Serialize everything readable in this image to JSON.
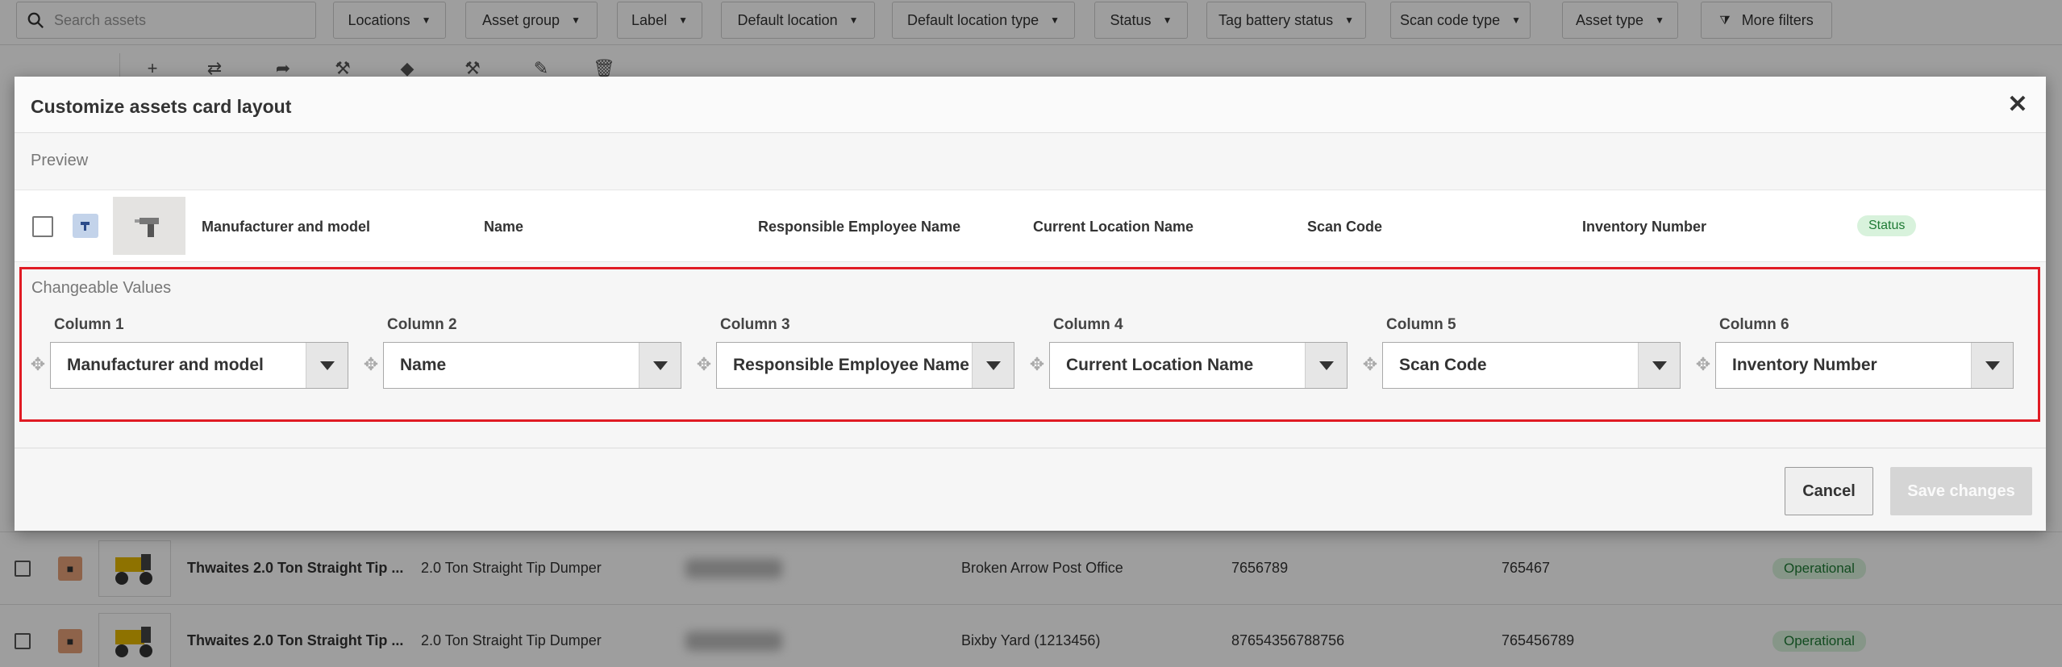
{
  "search": {
    "placeholder": "Search assets"
  },
  "filters": [
    "Locations",
    "Asset group",
    "Label",
    "Default location",
    "Default location type",
    "Status",
    "Tag battery status",
    "Scan code type",
    "Asset type",
    "More filters"
  ],
  "background_table": {
    "rows": [
      {
        "name": "Thwaites 2.0 Ton Straight Tip ...",
        "model": "2.0 Ton Straight Tip Dumper",
        "location": "Broken Arrow Post Office",
        "scan_code": "7656789",
        "inventory": "765467",
        "status": "Operational"
      },
      {
        "name": "Thwaites 2.0 Ton Straight Tip ...",
        "model": "2.0 Ton Straight Tip Dumper",
        "location": "Bixby Yard (1213456)",
        "scan_code": "87654356788756",
        "inventory": "765456789",
        "status": "Operational"
      }
    ]
  },
  "modal": {
    "title": "Customize assets card layout",
    "preview_label": "Preview",
    "preview_columns": [
      "Manufacturer and model",
      "Name",
      "Responsible Employee Name",
      "Current Location Name",
      "Scan Code",
      "Inventory Number"
    ],
    "preview_status": "Status",
    "changeable_label": "Changeable Values",
    "columns": [
      {
        "label": "Column 1",
        "value": "Manufacturer and model"
      },
      {
        "label": "Column 2",
        "value": "Name"
      },
      {
        "label": "Column 3",
        "value": "Responsible Employee Name"
      },
      {
        "label": "Column 4",
        "value": "Current Location Name"
      },
      {
        "label": "Column 5",
        "value": "Scan Code"
      },
      {
        "label": "Column 6",
        "value": "Inventory Number"
      }
    ],
    "cancel_label": "Cancel",
    "save_label": "Save changes"
  },
  "colors": {
    "highlight_border": "#e01b24",
    "status_green_bg": "#d8f2dc",
    "status_green_text": "#1e7a34"
  },
  "icons": [
    "search-icon",
    "close-icon",
    "drag-handle-icon",
    "chevron-down-icon",
    "filter-icon",
    "drill-icon",
    "dumper-icon"
  ]
}
